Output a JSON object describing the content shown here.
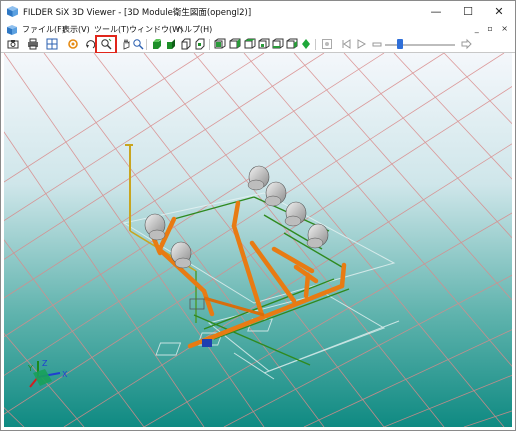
{
  "window": {
    "title": "FILDER SiX 3D Viewer - [3D Module衛生図面(opengl2)]",
    "minimize_glyph": "—",
    "maximize_glyph": "☐",
    "close_glyph": "✕",
    "icon": "app-cube-icon"
  },
  "menubar": {
    "items": [
      {
        "label": "ファイル(F)"
      },
      {
        "label": "表示(V)"
      },
      {
        "label": "ツール(T)"
      },
      {
        "label": "ウィンドウ(W)"
      },
      {
        "label": "ヘルプ(H)"
      }
    ],
    "mdi_controls": "_ ▫ ×"
  },
  "toolbar": {
    "icons": [
      "camera-icon",
      "print-icon",
      "grid-view-icon",
      "orbit-icon",
      "rotate-icon",
      "zoom-region-icon",
      "pan-hand-icon",
      "zoom-icon",
      "view-iso-front-icon",
      "view-iso-right-icon",
      "view-iso-back-icon",
      "view-iso-left-icon",
      "view-front-icon",
      "view-right-icon",
      "view-back-icon",
      "view-left-icon",
      "view-top-icon",
      "view-bottom-icon",
      "view-green-diamond-icon",
      "record-icon",
      "step-back-icon",
      "play-icon",
      "stop-icon",
      "slider-icon",
      "end-icon"
    ],
    "highlighted_tool": "zoom-region-icon",
    "highlight_color": "#e0261b"
  },
  "viewport": {
    "background_top": "#f4f7fb",
    "background_bottom": "#0f8a82",
    "grid_color": "#d98a8a",
    "pipe_orange": "#e87b13",
    "pipe_green": "#2f8a1f",
    "axis": {
      "z": "Z",
      "y": "Y",
      "x": "X"
    }
  }
}
